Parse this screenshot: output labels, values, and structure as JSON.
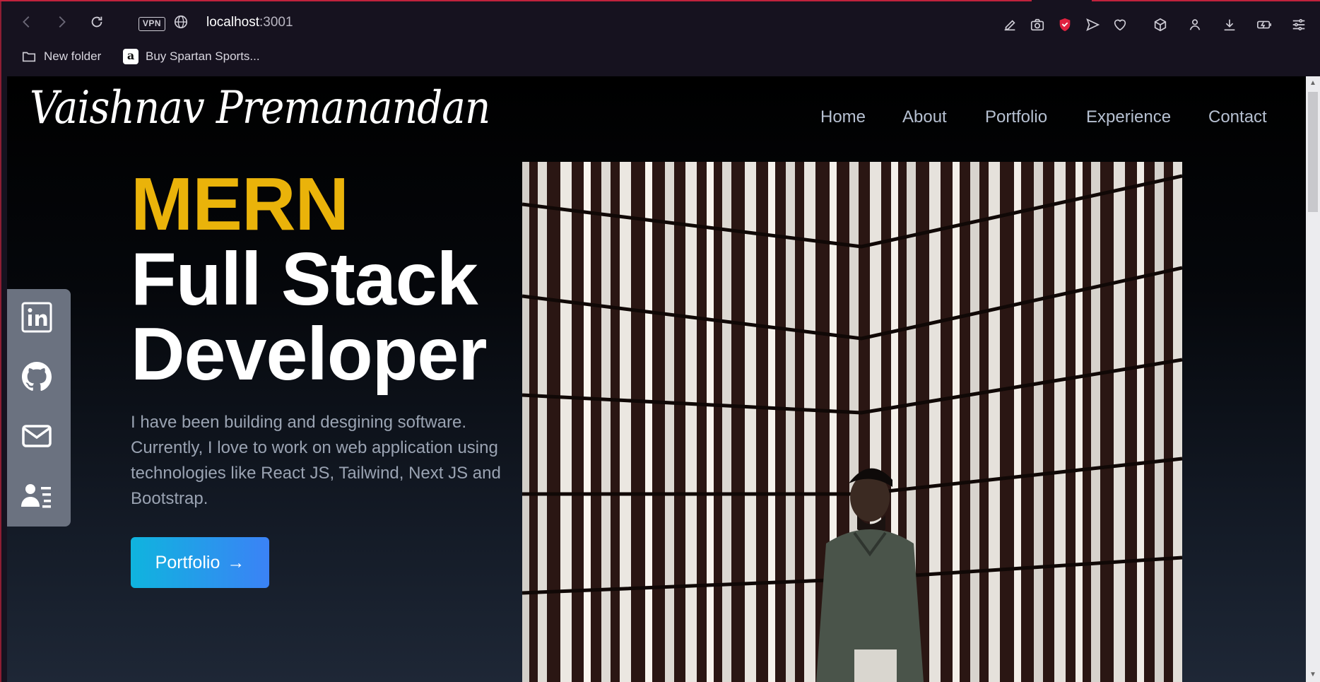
{
  "browser": {
    "url_host": "localhost",
    "url_port": ":3001",
    "vpn_label": "VPN",
    "bookmarks": [
      {
        "label": "New folder",
        "icon": "folder-icon"
      },
      {
        "label": "Buy Spartan Sports...",
        "icon": "amazon-icon"
      }
    ]
  },
  "site": {
    "logo": "Vaishnav Premanandan",
    "nav": [
      "Home",
      "About",
      "Portfolio",
      "Experience",
      "Contact"
    ],
    "hero": {
      "line1": "MERN",
      "line2": "Full Stack",
      "line3": "Developer",
      "description": "I have been building and desgining software. Currently, I love to work on web application using technologies like React JS, Tailwind, Next JS and Bootstrap.",
      "cta_label": "Portfolio",
      "cta_arrow": "→"
    },
    "social": [
      "linkedin-icon",
      "github-icon",
      "mail-icon",
      "resume-icon"
    ],
    "colors": {
      "accent": "#eab30a",
      "cta_start": "#0fb4de",
      "cta_end": "#3b82f6",
      "social_bar": "#6b7280"
    }
  }
}
